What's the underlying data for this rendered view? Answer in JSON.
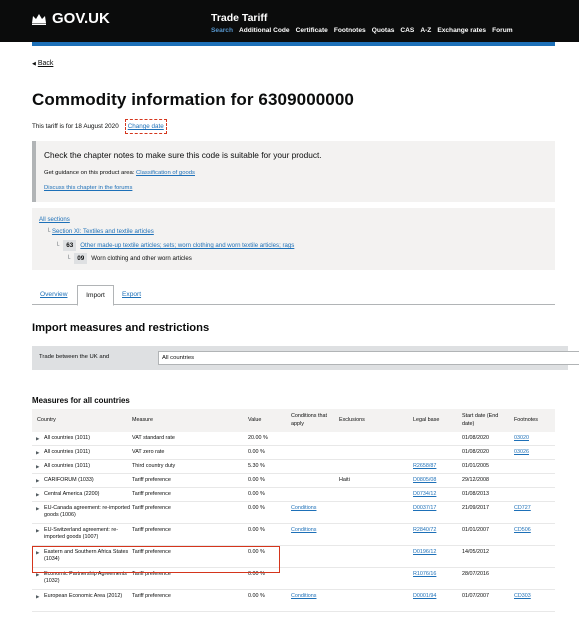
{
  "header": {
    "logo_text": "GOV.UK",
    "service_name": "Trade Tariff",
    "nav": [
      {
        "label": "Search",
        "active": true
      },
      {
        "label": "Additional Code",
        "active": false
      },
      {
        "label": "Certificate",
        "active": false
      },
      {
        "label": "Footnotes",
        "active": false
      },
      {
        "label": "Quotas",
        "active": false
      },
      {
        "label": "CAS",
        "active": false
      },
      {
        "label": "A-Z",
        "active": false
      },
      {
        "label": "Exchange rates",
        "active": false
      },
      {
        "label": "Forum",
        "active": false
      }
    ]
  },
  "back_link": "Back",
  "page_title": "Commodity information for 6309000000",
  "tariff_date": {
    "text": "This tariff is for 18 August 2020",
    "change_label": "Change date"
  },
  "notes": {
    "main": "Check the chapter notes to make sure this code is suitable for your product.",
    "guidance_prefix": "Get guidance on this product area: ",
    "guidance_link": "Classification of goods",
    "discuss_link": "Discuss this chapter in the forums"
  },
  "breadcrumbs": {
    "all_sections": "All sections",
    "section": "Section XI: Textiles and textile articles",
    "chapter_code": "63",
    "chapter": "Other made-up textile articles; sets; worn clothing and worn textile articles; rags",
    "heading_code": "09",
    "heading": "Worn clothing and other worn articles"
  },
  "tabs": [
    "Overview",
    "Import",
    "Export"
  ],
  "import_heading": "Import measures and restrictions",
  "trade": {
    "label": "Trade between the UK and",
    "selected": "All countries"
  },
  "measures_heading": "Measures for all countries",
  "table": {
    "headers": {
      "country": "Country",
      "measure": "Measure",
      "value": "Value",
      "conditions": "Conditions that apply",
      "exclusions": "Exclusions",
      "legal_base": "Legal base",
      "start_date": "Start date (End date)",
      "footnotes": "Footnotes"
    },
    "rows": [
      {
        "country": "All countries (1011)",
        "measure": "VAT standard rate",
        "value": "20.00 %",
        "conditions": "",
        "exclusions": "",
        "legal_base": "",
        "start": "01/08/2020",
        "footnotes": "03020"
      },
      {
        "country": "All countries (1011)",
        "measure": "VAT zero rate",
        "value": "0.00 %",
        "conditions": "",
        "exclusions": "",
        "legal_base": "",
        "start": "01/08/2020",
        "footnotes": "03026"
      },
      {
        "country": "All countries (1011)",
        "measure": "Third country duty",
        "value": "5.30 %",
        "conditions": "",
        "exclusions": "",
        "legal_base": "R2658/87",
        "start": "01/01/2005",
        "footnotes": ""
      },
      {
        "country": "CARIFORUM (1033)",
        "measure": "Tariff preference",
        "value": "0.00 %",
        "conditions": "",
        "exclusions": "Haiti",
        "legal_base": "D0805/08",
        "start": "29/12/2008",
        "footnotes": ""
      },
      {
        "country": "Central America (2200)",
        "measure": "Tariff preference",
        "value": "0.00 %",
        "conditions": "",
        "exclusions": "",
        "legal_base": "D0734/12",
        "start": "01/08/2013",
        "footnotes": ""
      },
      {
        "country": "EU-Canada agreement: re-imported goods (1006)",
        "measure": "Tariff preference",
        "value": "0.00 %",
        "conditions": "Conditions",
        "exclusions": "",
        "legal_base": "D0037/17",
        "start": "21/09/2017",
        "footnotes": "CD727"
      },
      {
        "country": "EU-Switzerland agreement: re-imported goods (1007)",
        "measure": "Tariff preference",
        "value": "0.00 %",
        "conditions": "Conditions",
        "exclusions": "",
        "legal_base": "R2840/72",
        "start": "01/01/2007",
        "footnotes": "CD506"
      },
      {
        "country": "Eastern and Southern Africa States (1034)",
        "measure": "Tariff preference",
        "value": "0.00 %",
        "conditions": "",
        "exclusions": "",
        "legal_base": "D0196/12",
        "start": "14/05/2012",
        "footnotes": ""
      },
      {
        "country": "Economic Partnership Agreements (1032)",
        "measure": "Tariff preference",
        "value": "0.00 %",
        "conditions": "",
        "exclusions": "",
        "legal_base": "R1076/16",
        "start": "28/07/2016",
        "footnotes": ""
      },
      {
        "country": "European Economic Area (2012)",
        "measure": "Tariff preference",
        "value": "0.00 %",
        "conditions": "Conditions",
        "exclusions": "",
        "legal_base": "D0001/94",
        "start": "01/07/2007",
        "footnotes": "CD303"
      }
    ]
  }
}
